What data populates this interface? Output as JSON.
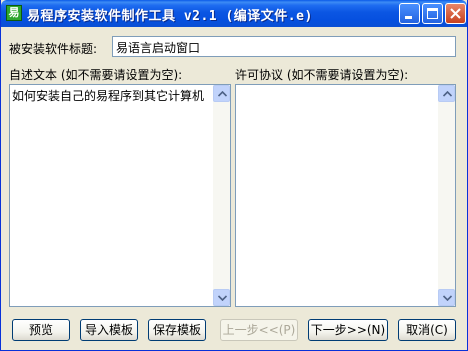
{
  "window": {
    "title": "易程序安装软件制作工具 v2.1 (编译文件.e)",
    "icon_char": "易"
  },
  "form": {
    "title_label": "被安装软件标题:",
    "title_value": "易语言启动窗口",
    "selftext_label": "自述文本 (如不需要请设置为空):",
    "selftext_value": "如何安装自己的易程序到其它计算机",
    "license_label": "许可协议 (如不需要请设置为空):",
    "license_value": ""
  },
  "buttons": {
    "preview": "预览",
    "import_template": "导入模板",
    "save_template": "保存模板",
    "prev": "上一步<<(P)",
    "next": "下一步>>(N)",
    "cancel": "取消(C)"
  },
  "colors": {
    "titlebar": "#0b56e3",
    "window_bg": "#ece9d8",
    "field_border": "#7f9db9"
  }
}
